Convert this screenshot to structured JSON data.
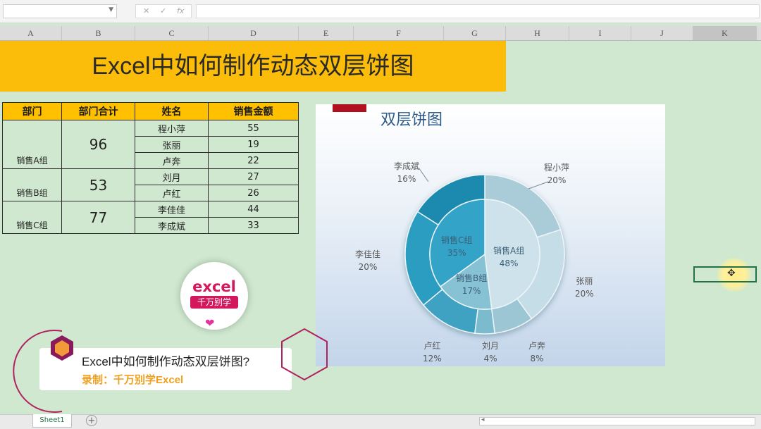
{
  "formula_bar": {
    "name_box": "",
    "formula": "",
    "fx_label": "fx"
  },
  "columns": [
    {
      "letter": "A"
    },
    {
      "letter": "B"
    },
    {
      "letter": "C"
    },
    {
      "letter": "D"
    },
    {
      "letter": "E"
    },
    {
      "letter": "F"
    },
    {
      "letter": "G"
    },
    {
      "letter": "H"
    },
    {
      "letter": "I"
    },
    {
      "letter": "J"
    },
    {
      "letter": "K"
    }
  ],
  "active_column": "K",
  "title": "Excel中如何制作动态双层饼图",
  "table": {
    "headers": [
      "部门",
      "部门合计",
      "姓名",
      "销售金额"
    ],
    "groups": [
      {
        "dept": "销售A组",
        "total": "96",
        "rows": [
          {
            "name": "程小萍",
            "amount": "55"
          },
          {
            "name": "张丽",
            "amount": "19"
          },
          {
            "name": "卢奔",
            "amount": "22"
          }
        ]
      },
      {
        "dept": "销售B组",
        "total": "53",
        "rows": [
          {
            "name": "刘月",
            "amount": "27"
          },
          {
            "name": "卢红",
            "amount": "26"
          }
        ]
      },
      {
        "dept": "销售C组",
        "total": "77",
        "rows": [
          {
            "name": "李佳佳",
            "amount": "44"
          },
          {
            "name": "李成斌",
            "amount": "33"
          }
        ]
      }
    ]
  },
  "chart": {
    "title": "双层饼图"
  },
  "chart_data": {
    "type": "pie",
    "title": "双层饼图",
    "rings": [
      {
        "ring": "outer",
        "slices": [
          {
            "label": "程小萍",
            "value": 20,
            "display": "20%",
            "color": "#a9ccd8"
          },
          {
            "label": "张丽",
            "value": 20,
            "display": "20%",
            "color": "#c5dde6"
          },
          {
            "label": "卢奔",
            "value": 8,
            "display": "8%",
            "color": "#9cc6d4"
          },
          {
            "label": "刘月",
            "value": 4,
            "display": "4%",
            "color": "#7cbace"
          },
          {
            "label": "卢红",
            "value": 12,
            "display": "12%",
            "color": "#3fa2c3"
          },
          {
            "label": "李佳佳",
            "value": 20,
            "display": "20%",
            "color": "#2a9dc1"
          },
          {
            "label": "李成斌",
            "value": 16,
            "display": "16%",
            "color": "#1e8aae"
          }
        ]
      },
      {
        "ring": "inner",
        "slices": [
          {
            "label": "销售A组",
            "value": 48,
            "display": "48%",
            "color": "#cde2ea"
          },
          {
            "label": "销售B组",
            "value": 17,
            "display": "17%",
            "color": "#86c1d4"
          },
          {
            "label": "销售C组",
            "value": 35,
            "display": "35%",
            "color": "#33a3c7"
          }
        ]
      }
    ]
  },
  "logo": {
    "text": "excel",
    "subtext": "千万别学",
    "heart": "❤"
  },
  "caption": {
    "line1": "Excel中如何制作动态双层饼图?",
    "line2": "录制：千万别学Excel"
  },
  "cursor": {
    "icon": "✥"
  },
  "sheet_tabs": [
    {
      "label": "Sheet1"
    }
  ],
  "add_sheet_label": "+",
  "colors": {
    "banner": "#fbbd0a",
    "table_header": "#ffc000",
    "sheet_bg": "#cfe8cf",
    "chart_title": "#2e5a88",
    "caption_accent": "#f0a020",
    "logo": "#d4185e"
  }
}
